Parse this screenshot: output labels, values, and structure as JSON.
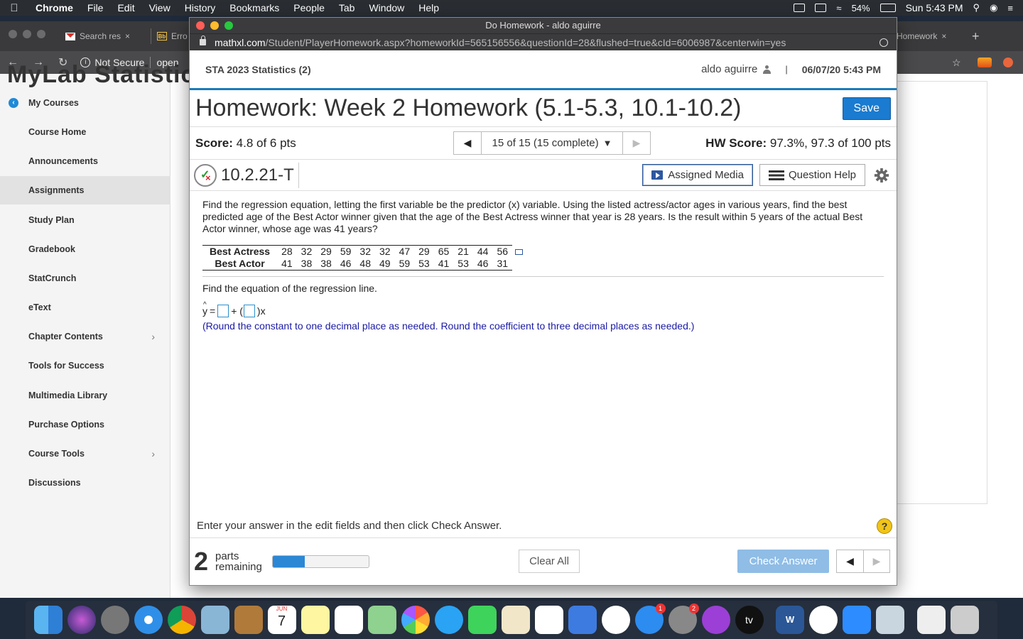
{
  "menubar": {
    "app": "Chrome",
    "items": [
      "File",
      "Edit",
      "View",
      "History",
      "Bookmarks",
      "People",
      "Tab",
      "Window",
      "Help"
    ],
    "battery": "54%",
    "clock": "Sun 5:43 PM"
  },
  "bg_browser": {
    "tab1": "Search res",
    "tab2": "Erro",
    "tab_right": "Homework",
    "not_secure": "Not Secure",
    "addr_partial": "open",
    "mylab_title": "MyLab Statistics"
  },
  "sidebar": {
    "items": [
      {
        "label": "My Courses"
      },
      {
        "label": "Course Home"
      },
      {
        "label": "Announcements"
      },
      {
        "label": "Assignments"
      },
      {
        "label": "Study Plan"
      },
      {
        "label": "Gradebook"
      },
      {
        "label": "StatCrunch"
      },
      {
        "label": "eText"
      },
      {
        "label": "Chapter Contents"
      },
      {
        "label": "Tools for Success"
      },
      {
        "label": "Multimedia Library"
      },
      {
        "label": "Purchase Options"
      },
      {
        "label": "Course Tools"
      },
      {
        "label": "Discussions"
      }
    ]
  },
  "hw_window": {
    "title": "Do Homework - aldo aguirre",
    "url_host": "mathxl.com",
    "url_path": "/Student/PlayerHomework.aspx?homeworkId=565156556&questionId=28&flushed=true&cId=6006987&centerwin=yes"
  },
  "header": {
    "course": "STA 2023 Statistics (2)",
    "user": "aldo aguirre",
    "separator": "|",
    "datetime": "06/07/20 5:43 PM"
  },
  "homework": {
    "title": "Homework: Week 2 Homework (5.1-5.3, 10.1-10.2)",
    "save": "Save",
    "score_label": "Score:",
    "score_value": "4.8 of 6 pts",
    "question_nav": "15 of 15 (15 complete)",
    "hw_score_label": "HW Score:",
    "hw_score_value": "97.3%, 97.3 of 100 pts"
  },
  "question": {
    "id": "10.2.21-T",
    "assigned_media": "Assigned Media",
    "question_help": "Question Help",
    "prompt": "Find the regression equation, letting the first variable be the predictor (x) variable. Using the listed actress/actor ages in various years, find the best predicted age of the Best Actor winner given that the age of the Best Actress winner that year is 28 years. Is the result within 5 years of the actual Best Actor winner, whose age was 41 years?",
    "table": {
      "row1_label": "Best Actress",
      "row1": [
        "28",
        "32",
        "29",
        "59",
        "32",
        "32",
        "47",
        "29",
        "65",
        "21",
        "44",
        "56"
      ],
      "row2_label": "Best Actor",
      "row2": [
        "41",
        "38",
        "38",
        "46",
        "48",
        "49",
        "59",
        "53",
        "41",
        "53",
        "46",
        "31"
      ]
    },
    "subprompt": "Find the equation of the regression line.",
    "eq_y": "y",
    "eq_equals": "=",
    "eq_plus": "+ (",
    "eq_x": ")x",
    "round_note": "(Round the constant to one decimal place as needed. Round the coefficient to three decimal places as needed.)"
  },
  "footer": {
    "instruction": "Enter your answer in the edit fields and then click Check Answer.",
    "help_symbol": "?",
    "parts_count": "2",
    "parts_text1": "parts",
    "parts_text2": "remaining",
    "progress_fraction": 0.33,
    "clear_all": "Clear All",
    "check_answer": "Check Answer"
  },
  "dock": {
    "calendar_month": "JUN",
    "calendar_day": "7",
    "appstore_badge": "1",
    "prefs_badge": "2",
    "tv_label": "tv",
    "word_label": "W"
  },
  "colors": {
    "accent": "#1a7bb9",
    "save_button": "#1a7bd0",
    "progress_fill": "#2c87d4",
    "round_note": "#1a1aa6"
  }
}
